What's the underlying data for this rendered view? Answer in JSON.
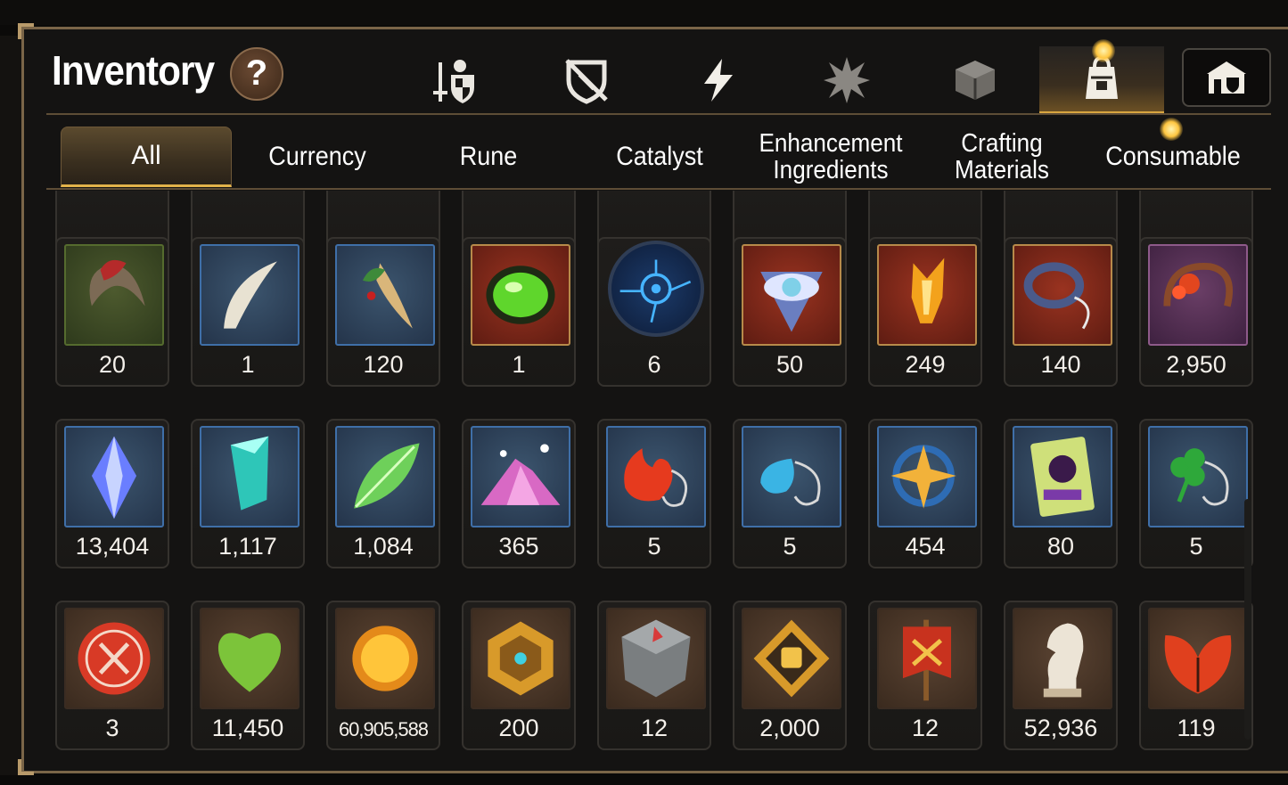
{
  "window": {
    "title": "Inventory",
    "help_label": "?"
  },
  "category_tabs": [
    {
      "icon": "gear-weapon-icon",
      "active": false
    },
    {
      "icon": "broken-shield-icon",
      "active": false
    },
    {
      "icon": "lightning-icon",
      "active": false
    },
    {
      "icon": "spiky-burst-icon",
      "active": false
    },
    {
      "icon": "cube-icon",
      "active": false
    },
    {
      "icon": "backpack-icon",
      "active": true
    }
  ],
  "guild_button": {
    "icon": "guild-hall-icon"
  },
  "subtabs": [
    {
      "label": "All",
      "active": true
    },
    {
      "label": "Currency"
    },
    {
      "label": "Rune"
    },
    {
      "label": "Catalyst"
    },
    {
      "label": "Enhancement Ingredients"
    },
    {
      "label": "Crafting Materials"
    },
    {
      "label": "Consumable"
    }
  ],
  "colors": {
    "accent_gold": "#e2b24a",
    "frame": "#7a6548",
    "panel_bg": "#141312"
  },
  "items": {
    "row1": [
      {
        "icon": "red-claw-icon",
        "count": "20",
        "bg": "green"
      },
      {
        "icon": "white-fang-icon",
        "count": "1",
        "bg": "blue"
      },
      {
        "icon": "ginseng-root-icon",
        "count": "120",
        "bg": "blue"
      },
      {
        "icon": "green-gem-icon",
        "count": "1",
        "bg": "red"
      },
      {
        "icon": "blue-rune-disc-icon",
        "count": "6",
        "bg": "round"
      },
      {
        "icon": "eye-emblem-icon",
        "count": "50",
        "bg": "red"
      },
      {
        "icon": "flame-crystal-icon",
        "count": "249",
        "bg": "red"
      },
      {
        "icon": "charm-ring-icon",
        "count": "140",
        "bg": "red"
      },
      {
        "icon": "flower-pendant-icon",
        "count": "2,950",
        "bg": "purple"
      }
    ],
    "row2": [
      {
        "icon": "blue-crystal-icon",
        "count": "13,404",
        "bg": "blue"
      },
      {
        "icon": "teal-crystal-icon",
        "count": "1,117",
        "bg": "blue"
      },
      {
        "icon": "glowing-leaf-icon",
        "count": "1,084",
        "bg": "blue"
      },
      {
        "icon": "pink-powder-icon",
        "count": "365",
        "bg": "blue"
      },
      {
        "icon": "fire-charm-icon",
        "count": "5",
        "bg": "blue"
      },
      {
        "icon": "water-charm-icon",
        "count": "5",
        "bg": "blue"
      },
      {
        "icon": "star-charm-icon",
        "count": "454",
        "bg": "blue"
      },
      {
        "icon": "card-icon",
        "count": "80",
        "bg": "blue"
      },
      {
        "icon": "clover-charm-icon",
        "count": "5",
        "bg": "blue"
      }
    ],
    "row3": [
      {
        "icon": "red-seal-icon",
        "count": "3",
        "bg": "brown"
      },
      {
        "icon": "green-heart-icon",
        "count": "11,450",
        "bg": "brown"
      },
      {
        "icon": "gold-coin-icon",
        "count": "60,905,588",
        "bg": "brown"
      },
      {
        "icon": "gold-emblem-icon",
        "count": "200",
        "bg": "brown"
      },
      {
        "icon": "stone-cube-icon",
        "count": "12",
        "bg": "brown"
      },
      {
        "icon": "fist-badge-icon",
        "count": "2,000",
        "bg": "brown"
      },
      {
        "icon": "war-banner-icon",
        "count": "12",
        "bg": "brown"
      },
      {
        "icon": "chess-knight-icon",
        "count": "52,936",
        "bg": "brown"
      },
      {
        "icon": "red-leaf-icon",
        "count": "119",
        "bg": "brown"
      }
    ]
  }
}
